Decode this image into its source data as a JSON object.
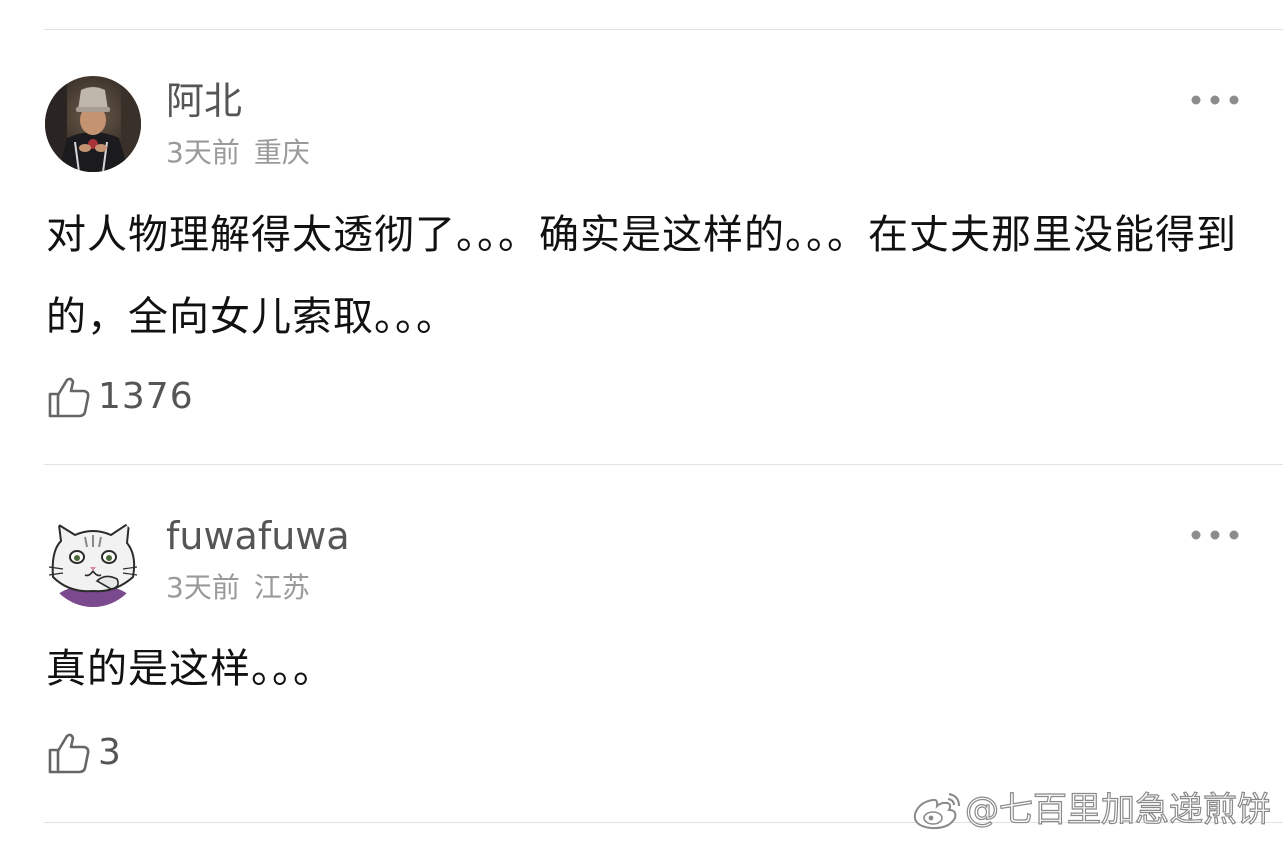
{
  "comments": [
    {
      "username": "阿北",
      "time": "3天前",
      "location": "重庆",
      "text": "对人物理解得太透彻了。。。确实是这样的。。。在丈夫那里没能得到的，全向女儿索取。。。",
      "likes": "1376",
      "avatar_icon": "person-with-hat-avatar",
      "more_icon": "more-dots-icon",
      "like_icon": "thumbs-up-icon"
    },
    {
      "username": "fuwafuwa",
      "time": "3天前",
      "location": "江苏",
      "text": "真的是这样。。。",
      "likes": "3",
      "avatar_icon": "cartoon-cat-avatar",
      "more_icon": "more-dots-icon",
      "like_icon": "thumbs-up-icon"
    }
  ],
  "watermark": {
    "text": "@七百里加急递煎饼",
    "icon": "weibo-logo-icon"
  },
  "colors": {
    "username": "#555555",
    "meta": "#9a9a9a",
    "text": "#111111",
    "divider": "#e2e2e2",
    "cat_avatar_accent": "#7b4a8e"
  }
}
